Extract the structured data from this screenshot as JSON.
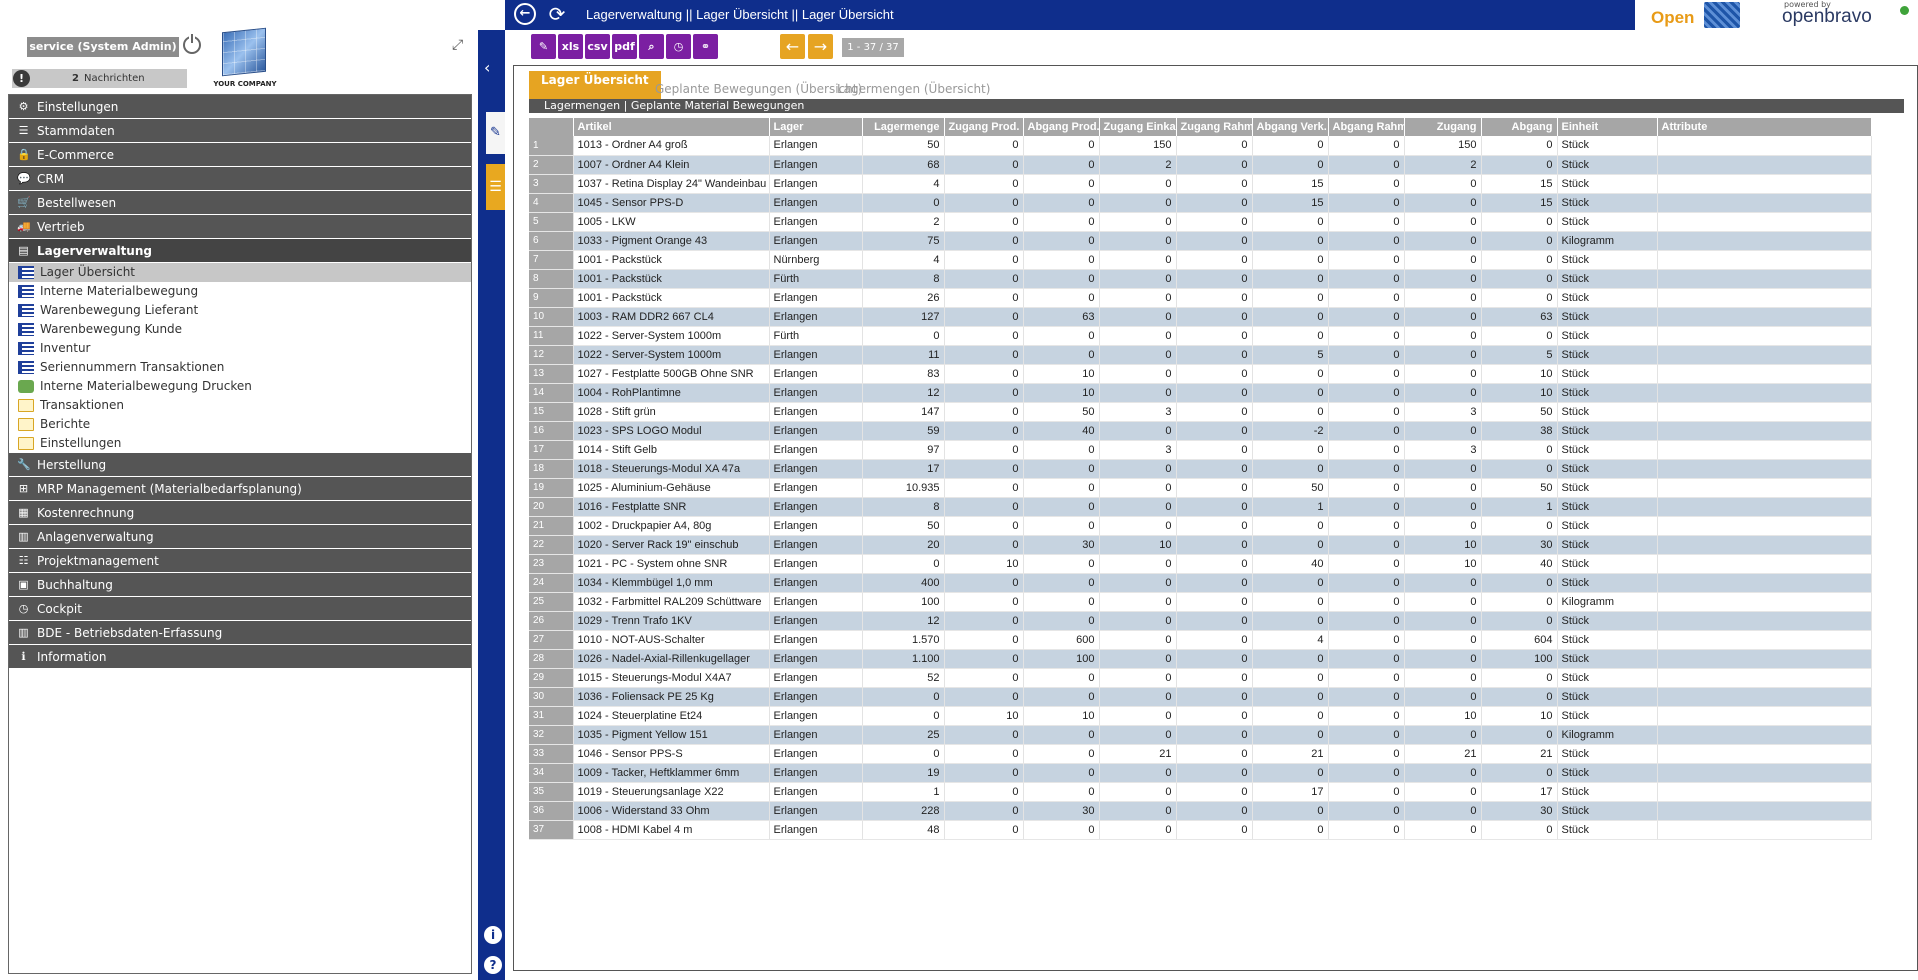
{
  "topbar": {
    "breadcrumb": "Lagerverwaltung || Lager Übersicht  ||  Lager Übersicht",
    "logo_openz": "Open",
    "powered_by": "powered by",
    "logo_openbravo": "openbravo"
  },
  "user": {
    "name": "service (System Admin)",
    "message_count": "2",
    "messages_label": "Nachrichten",
    "company": "YOUR COMPANY"
  },
  "menu": [
    {
      "label": "Einstellungen",
      "icon": "gear-icon",
      "glyph": "⚙"
    },
    {
      "label": "Stammdaten",
      "icon": "list-icon",
      "glyph": "☰"
    },
    {
      "label": "E-Commerce",
      "icon": "lock-icon",
      "glyph": "🔒"
    },
    {
      "label": "CRM",
      "icon": "chat-icon",
      "glyph": "💬"
    },
    {
      "label": "Bestellwesen",
      "icon": "cart-icon",
      "glyph": "🛒"
    },
    {
      "label": "Vertrieb",
      "icon": "truck-icon",
      "glyph": "🚚"
    },
    {
      "label": "Lagerverwaltung",
      "icon": "box-icon",
      "glyph": "▤",
      "open": true,
      "children": [
        {
          "label": "Lager Übersicht",
          "icon": "list",
          "selected": true
        },
        {
          "label": "Interne Materialbewegung",
          "icon": "list"
        },
        {
          "label": "Warenbewegung Lieferant",
          "icon": "list"
        },
        {
          "label": "Warenbewegung Kunde",
          "icon": "list"
        },
        {
          "label": "Inventur",
          "icon": "list"
        },
        {
          "label": "Seriennummern Transaktionen",
          "icon": "list"
        },
        {
          "label": "Interne Materialbewegung Drucken",
          "icon": "gear"
        },
        {
          "label": "Transaktionen",
          "icon": "folder"
        },
        {
          "label": "Berichte",
          "icon": "folder"
        },
        {
          "label": "Einstellungen",
          "icon": "folder"
        }
      ]
    },
    {
      "label": "Herstellung",
      "icon": "wrench-icon",
      "glyph": "🔧"
    },
    {
      "label": "MRP Management (Materialbedarfsplanung)",
      "icon": "sitemap-icon",
      "glyph": "⊞"
    },
    {
      "label": "Kostenrechnung",
      "icon": "calculator-icon",
      "glyph": "▦"
    },
    {
      "label": "Anlagenverwaltung",
      "icon": "chart-icon",
      "glyph": "▥"
    },
    {
      "label": "Projektmanagement",
      "icon": "tasks-icon",
      "glyph": "☷"
    },
    {
      "label": "Buchhaltung",
      "icon": "money-icon",
      "glyph": "▣"
    },
    {
      "label": "Cockpit",
      "icon": "dashboard-icon",
      "glyph": "◷"
    },
    {
      "label": "BDE - Betriebsdaten-Erfassung",
      "icon": "barcode-icon",
      "glyph": "▥"
    },
    {
      "label": "Information",
      "icon": "info-icon",
      "glyph": "ℹ"
    }
  ],
  "toolbar": {
    "buttons": [
      {
        "name": "attach-button",
        "label": "✎"
      },
      {
        "name": "export-xls-button",
        "label": "xls"
      },
      {
        "name": "export-csv-button",
        "label": "csv"
      },
      {
        "name": "export-pdf-button",
        "label": "pdf"
      },
      {
        "name": "search-button",
        "label": "⌕"
      },
      {
        "name": "history-button",
        "label": "◷"
      },
      {
        "name": "link-button",
        "label": "⚭"
      }
    ],
    "prev": "←",
    "next": "→",
    "record_count": "1 - 37 / 37"
  },
  "tabs": [
    "Lager Übersicht",
    "Geplante Bewegungen (Übersicht)",
    "Lagermengen (Übersicht)"
  ],
  "subtabs": "Lagermengen | Geplante Material Bewegungen",
  "grid": {
    "columns": [
      "",
      "Artikel",
      "Lager",
      "Lagermenge",
      "Zugang Prod.",
      "Abgang Prod.",
      "Zugang Einkauf",
      "Zugang Rahm",
      "Abgang Verk.",
      "Abgang Rahm",
      "Zugang",
      "Abgang",
      "Einheit",
      "Attribute"
    ],
    "rows": [
      [
        "1",
        "1013 - Ordner A4 groß",
        "Erlangen",
        "50",
        "0",
        "0",
        "150",
        "0",
        "0",
        "0",
        "150",
        "0",
        "Stück",
        ""
      ],
      [
        "2",
        "1007 - Ordner A4 Klein",
        "Erlangen",
        "68",
        "0",
        "0",
        "2",
        "0",
        "0",
        "0",
        "2",
        "0",
        "Stück",
        ""
      ],
      [
        "3",
        "1037 - Retina Display 24\" Wandeinbau",
        "Erlangen",
        "4",
        "0",
        "0",
        "0",
        "0",
        "15",
        "0",
        "0",
        "15",
        "Stück",
        ""
      ],
      [
        "4",
        "1045 - Sensor PPS-D",
        "Erlangen",
        "0",
        "0",
        "0",
        "0",
        "0",
        "15",
        "0",
        "0",
        "15",
        "Stück",
        ""
      ],
      [
        "5",
        "1005 - LKW",
        "Erlangen",
        "2",
        "0",
        "0",
        "0",
        "0",
        "0",
        "0",
        "0",
        "0",
        "Stück",
        ""
      ],
      [
        "6",
        "1033 - Pigment Orange 43",
        "Erlangen",
        "75",
        "0",
        "0",
        "0",
        "0",
        "0",
        "0",
        "0",
        "0",
        "Kilogramm",
        ""
      ],
      [
        "7",
        "1001 - Packstück",
        "Nürnberg",
        "4",
        "0",
        "0",
        "0",
        "0",
        "0",
        "0",
        "0",
        "0",
        "Stück",
        ""
      ],
      [
        "8",
        "1001 - Packstück",
        "Fürth",
        "8",
        "0",
        "0",
        "0",
        "0",
        "0",
        "0",
        "0",
        "0",
        "Stück",
        ""
      ],
      [
        "9",
        "1001 - Packstück",
        "Erlangen",
        "26",
        "0",
        "0",
        "0",
        "0",
        "0",
        "0",
        "0",
        "0",
        "Stück",
        ""
      ],
      [
        "10",
        "1003 - RAM DDR2 667 CL4",
        "Erlangen",
        "127",
        "0",
        "63",
        "0",
        "0",
        "0",
        "0",
        "0",
        "63",
        "Stück",
        ""
      ],
      [
        "11",
        "1022 - Server-System 1000m",
        "Fürth",
        "0",
        "0",
        "0",
        "0",
        "0",
        "0",
        "0",
        "0",
        "0",
        "Stück",
        ""
      ],
      [
        "12",
        "1022 - Server-System 1000m",
        "Erlangen",
        "11",
        "0",
        "0",
        "0",
        "0",
        "5",
        "0",
        "0",
        "5",
        "Stück",
        ""
      ],
      [
        "13",
        "1027 - Festplatte 500GB Ohne SNR",
        "Erlangen",
        "83",
        "0",
        "10",
        "0",
        "0",
        "0",
        "0",
        "0",
        "10",
        "Stück",
        ""
      ],
      [
        "14",
        "1004 - RohPlantimne",
        "Erlangen",
        "12",
        "0",
        "10",
        "0",
        "0",
        "0",
        "0",
        "0",
        "10",
        "Stück",
        ""
      ],
      [
        "15",
        "1028 - Stift grün",
        "Erlangen",
        "147",
        "0",
        "50",
        "3",
        "0",
        "0",
        "0",
        "3",
        "50",
        "Stück",
        ""
      ],
      [
        "16",
        "1023 - SPS LOGO Modul",
        "Erlangen",
        "59",
        "0",
        "40",
        "0",
        "0",
        "-2",
        "0",
        "0",
        "38",
        "Stück",
        ""
      ],
      [
        "17",
        "1014 - Stift  Gelb",
        "Erlangen",
        "97",
        "0",
        "0",
        "3",
        "0",
        "0",
        "0",
        "3",
        "0",
        "Stück",
        ""
      ],
      [
        "18",
        "1018 - Steuerungs-Modul XA 47a",
        "Erlangen",
        "17",
        "0",
        "0",
        "0",
        "0",
        "0",
        "0",
        "0",
        "0",
        "Stück",
        ""
      ],
      [
        "19",
        "1025 - Aluminium-Gehäuse",
        "Erlangen",
        "10.935",
        "0",
        "0",
        "0",
        "0",
        "50",
        "0",
        "0",
        "50",
        "Stück",
        ""
      ],
      [
        "20",
        "1016 - Festplatte SNR",
        "Erlangen",
        "8",
        "0",
        "0",
        "0",
        "0",
        "1",
        "0",
        "0",
        "1",
        "Stück",
        ""
      ],
      [
        "21",
        "1002 - Druckpapier A4, 80g",
        "Erlangen",
        "50",
        "0",
        "0",
        "0",
        "0",
        "0",
        "0",
        "0",
        "0",
        "Stück",
        ""
      ],
      [
        "22",
        "1020 - Server Rack 19\" einschub",
        "Erlangen",
        "20",
        "0",
        "30",
        "10",
        "0",
        "0",
        "0",
        "10",
        "30",
        "Stück",
        ""
      ],
      [
        "23",
        "1021 - PC - System ohne SNR",
        "Erlangen",
        "0",
        "10",
        "0",
        "0",
        "0",
        "40",
        "0",
        "10",
        "40",
        "Stück",
        ""
      ],
      [
        "24",
        "1034 - Klemmbügel  1,0 mm",
        "Erlangen",
        "400",
        "0",
        "0",
        "0",
        "0",
        "0",
        "0",
        "0",
        "0",
        "Stück",
        ""
      ],
      [
        "25",
        "1032 - Farbmittel RAL209 Schüttware",
        "Erlangen",
        "100",
        "0",
        "0",
        "0",
        "0",
        "0",
        "0",
        "0",
        "0",
        "Kilogramm",
        ""
      ],
      [
        "26",
        "1029 - Trenn Trafo 1KV",
        "Erlangen",
        "12",
        "0",
        "0",
        "0",
        "0",
        "0",
        "0",
        "0",
        "0",
        "Stück",
        ""
      ],
      [
        "27",
        "1010 - NOT-AUS-Schalter",
        "Erlangen",
        "1.570",
        "0",
        "600",
        "0",
        "0",
        "4",
        "0",
        "0",
        "604",
        "Stück",
        ""
      ],
      [
        "28",
        "1026 - Nadel-Axial-Rillenkugellager",
        "Erlangen",
        "1.100",
        "0",
        "100",
        "0",
        "0",
        "0",
        "0",
        "0",
        "100",
        "Stück",
        ""
      ],
      [
        "29",
        "1015 - Steuerungs-Modul X4A7",
        "Erlangen",
        "52",
        "0",
        "0",
        "0",
        "0",
        "0",
        "0",
        "0",
        "0",
        "Stück",
        ""
      ],
      [
        "30",
        "1036 - Foliensack PE 25 Kg",
        "Erlangen",
        "0",
        "0",
        "0",
        "0",
        "0",
        "0",
        "0",
        "0",
        "0",
        "Stück",
        ""
      ],
      [
        "31",
        "1024 - Steuerplatine Et24",
        "Erlangen",
        "0",
        "10",
        "10",
        "0",
        "0",
        "0",
        "0",
        "10",
        "10",
        "Stück",
        ""
      ],
      [
        "32",
        "1035 - Pigment Yellow 151",
        "Erlangen",
        "25",
        "0",
        "0",
        "0",
        "0",
        "0",
        "0",
        "0",
        "0",
        "Kilogramm",
        ""
      ],
      [
        "33",
        "1046 - Sensor PPS-S",
        "Erlangen",
        "0",
        "0",
        "0",
        "21",
        "0",
        "21",
        "0",
        "21",
        "21",
        "Stück",
        ""
      ],
      [
        "34",
        "1009 - Tacker, Heftklammer 6mm",
        "Erlangen",
        "19",
        "0",
        "0",
        "0",
        "0",
        "0",
        "0",
        "0",
        "0",
        "Stück",
        ""
      ],
      [
        "35",
        "1019 - Steuerungsanlage X22",
        "Erlangen",
        "1",
        "0",
        "0",
        "0",
        "0",
        "17",
        "0",
        "0",
        "17",
        "Stück",
        ""
      ],
      [
        "36",
        "1006 - Widerstand 33 Ohm",
        "Erlangen",
        "228",
        "0",
        "30",
        "0",
        "0",
        "0",
        "0",
        "0",
        "30",
        "Stück",
        ""
      ],
      [
        "37",
        "1008 - HDMI Kabel 4 m",
        "Erlangen",
        "48",
        "0",
        "0",
        "0",
        "0",
        "0",
        "0",
        "0",
        "0",
        "Stück",
        ""
      ]
    ]
  }
}
